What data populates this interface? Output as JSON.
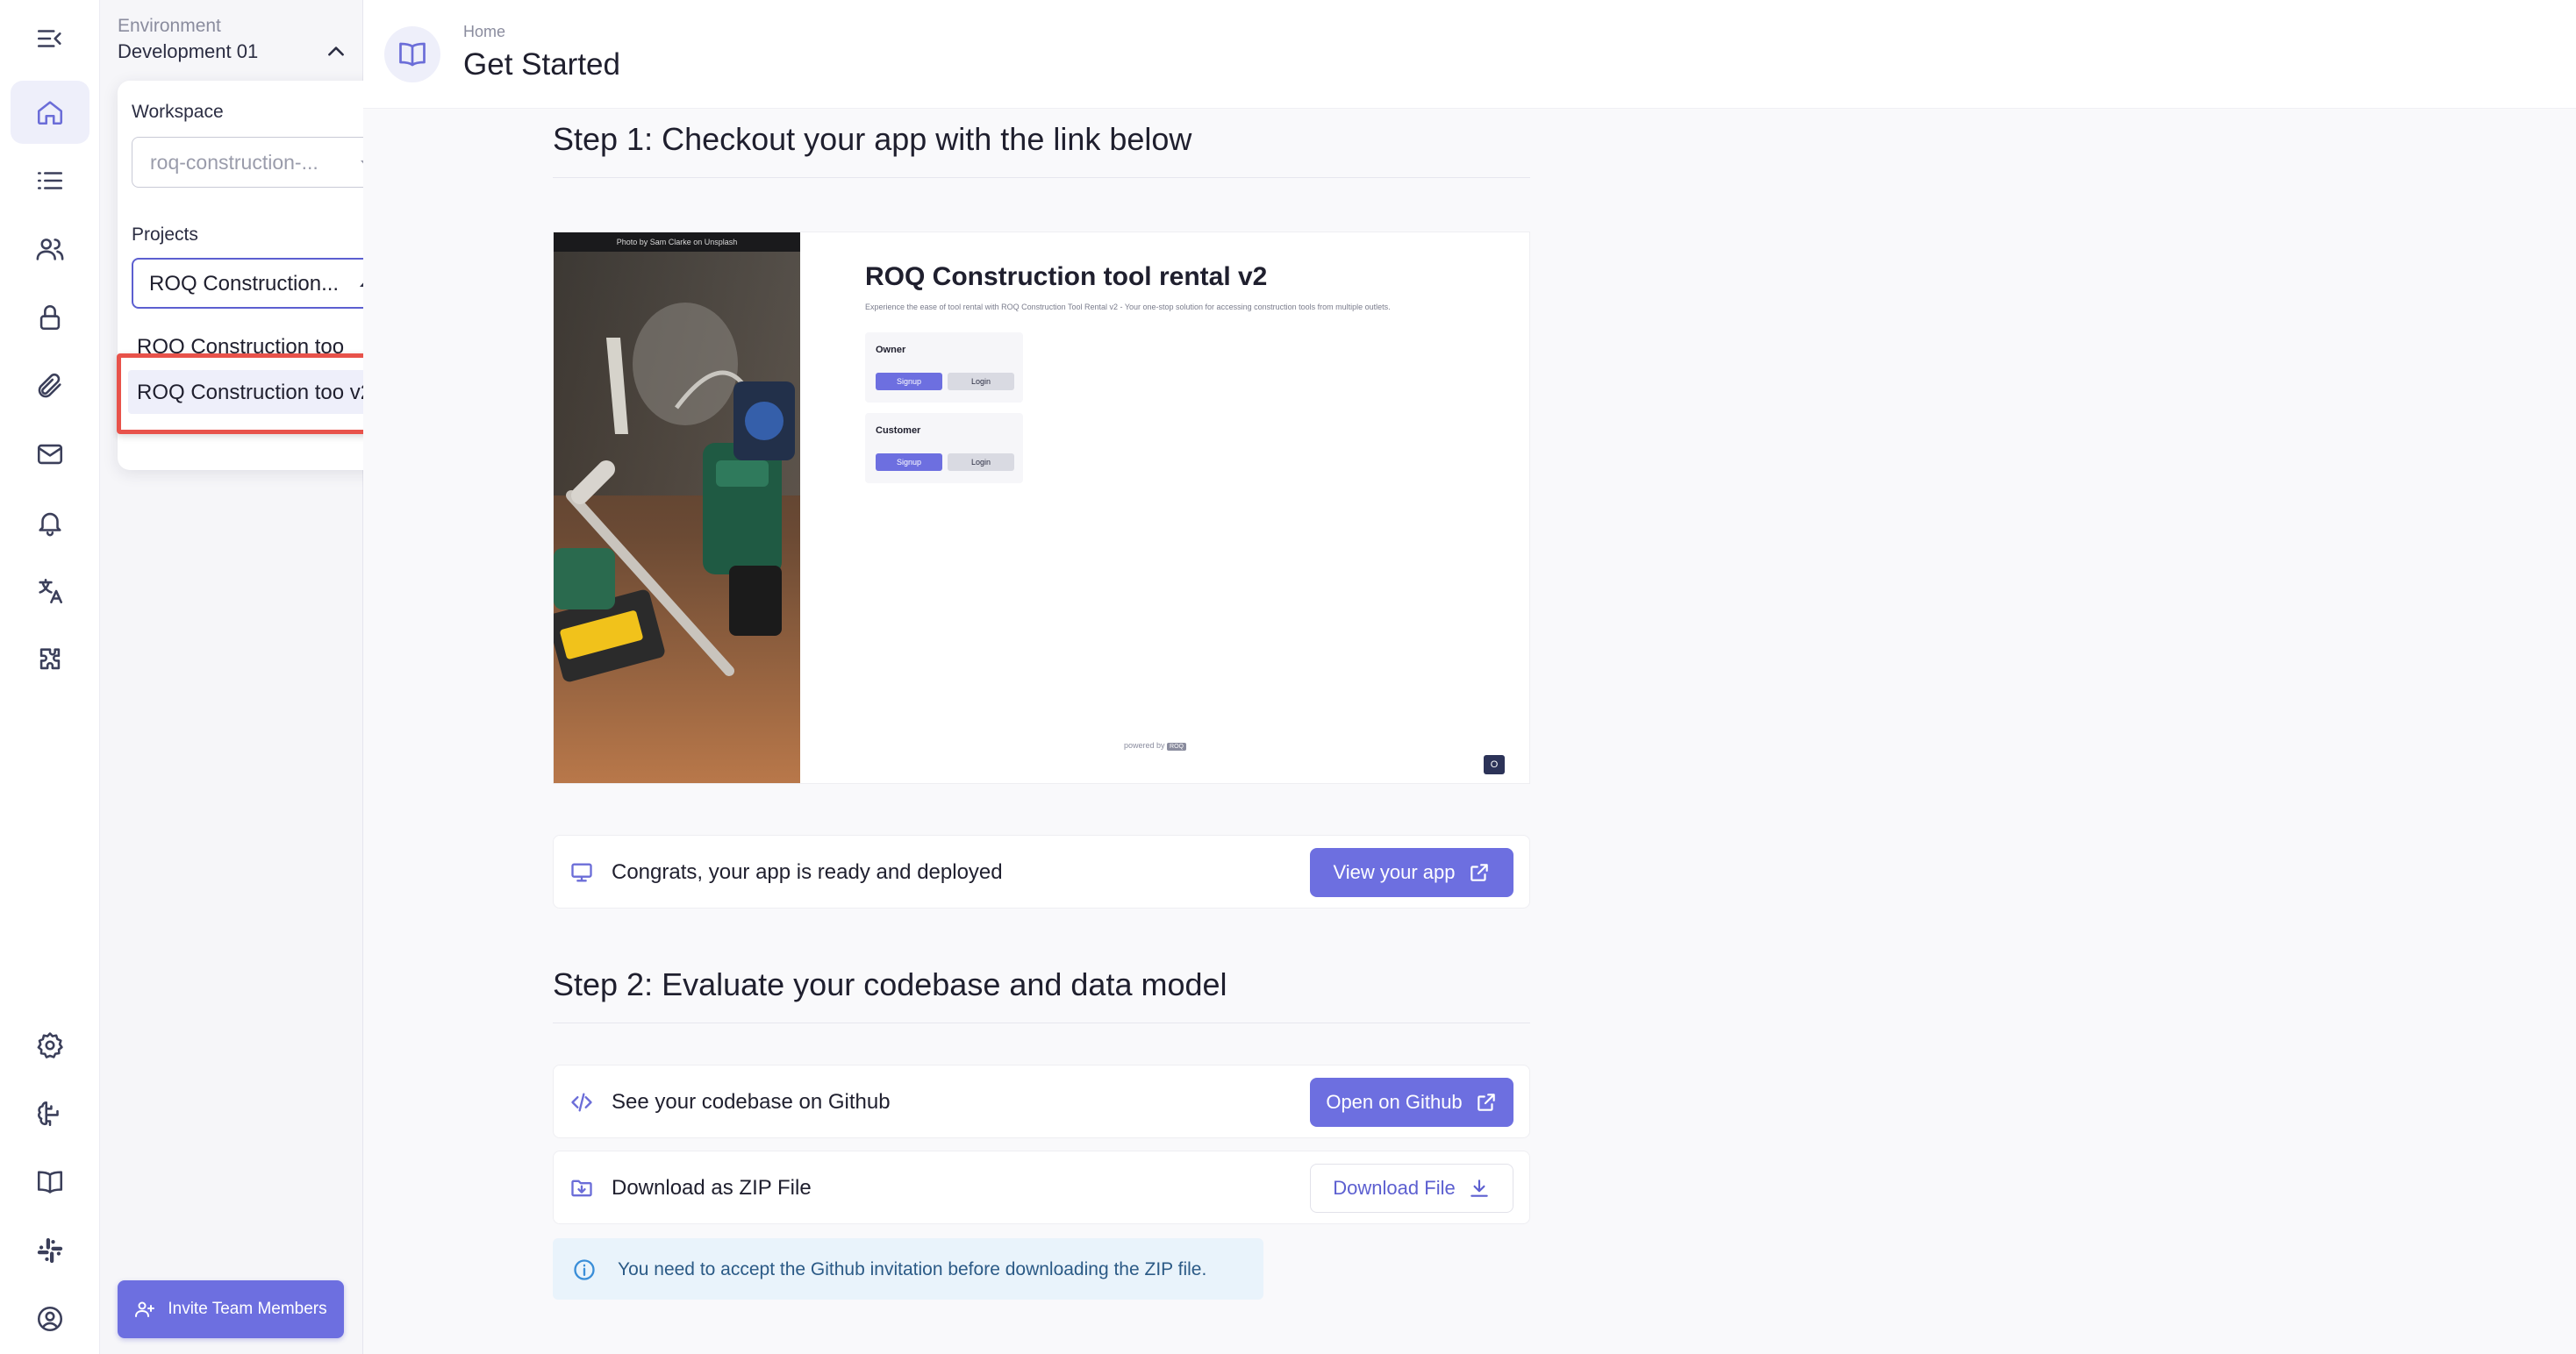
{
  "environment": {
    "label": "Environment",
    "value": "Development 01"
  },
  "workspace": {
    "label": "Workspace",
    "value": "roq-construction-..."
  },
  "projects": {
    "label": "Projects",
    "selected": "ROQ Construction...",
    "options": [
      {
        "label": "ROQ Construction too"
      },
      {
        "label": "ROQ Construction too v2"
      }
    ]
  },
  "invite_button": {
    "label": "Invite Team Members"
  },
  "header": {
    "breadcrumb": "Home",
    "title": "Get Started"
  },
  "step1": {
    "title": "Step 1: Checkout your app with the link below",
    "preview": {
      "photo_credit": "Photo by Sam Clarke on Unsplash",
      "app_title": "ROQ Construction tool rental v2",
      "app_description": "Experience the ease of tool rental with ROQ Construction Tool Rental v2 - Your one-stop solution for accessing construction tools from multiple outlets.",
      "roles": [
        {
          "name": "Owner",
          "signup": "Signup",
          "login": "Login"
        },
        {
          "name": "Customer",
          "signup": "Signup",
          "login": "Login"
        }
      ],
      "powered_by": "powered by",
      "powered_logo": "ROQ",
      "corner_badge": "O"
    },
    "deploy_row": {
      "text": "Congrats, your app is ready and deployed",
      "button": "View your app"
    }
  },
  "step2": {
    "title": "Step 2: Evaluate your codebase and data model",
    "github_row": {
      "text": "See your codebase on Github",
      "button": "Open on Github"
    },
    "zip_row": {
      "text": "Download as ZIP File",
      "button": "Download File"
    },
    "info": "You need to accept the Github invitation before downloading the ZIP file."
  },
  "colors": {
    "accent": "#6d6fe0",
    "highlight": "#e8524a",
    "info_bg": "#e9f3fb"
  },
  "icons": {
    "rail": [
      "collapse-menu-icon",
      "home-icon",
      "list-icon",
      "users-icon",
      "lock-icon",
      "paperclip-icon",
      "mail-icon",
      "bell-icon",
      "translate-icon",
      "puzzle-icon",
      "gear-icon",
      "brain-icon",
      "book-icon",
      "slack-icon",
      "user-circle-icon"
    ]
  }
}
